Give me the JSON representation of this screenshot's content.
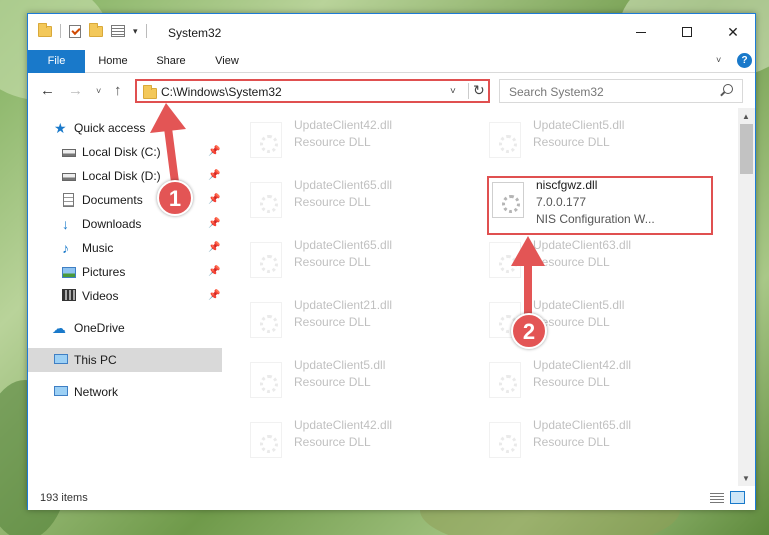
{
  "window": {
    "title": "System32",
    "minimize_icon": "minimize-icon",
    "maximize_icon": "maximize-icon",
    "close_symbol": "✕"
  },
  "ribbon": {
    "tabs": [
      {
        "label": "File"
      },
      {
        "label": "Home"
      },
      {
        "label": "Share"
      },
      {
        "label": "View"
      }
    ],
    "help_label": "?"
  },
  "nav": {
    "back_symbol": "←",
    "forward_symbol": "→",
    "recent_symbol": "˅",
    "up_symbol": "↑",
    "address_path": "C:\\Windows\\System32",
    "address_dropdown_symbol": "˅",
    "refresh_symbol": "↻",
    "search_placeholder": "Search System32"
  },
  "sidebar": {
    "items": [
      {
        "label": "Quick access",
        "icon": "star-icon"
      },
      {
        "label": "Local Disk (C:)",
        "icon": "disk-icon",
        "pinned": true
      },
      {
        "label": "Local Disk (D:)",
        "icon": "disk-icon",
        "pinned": true
      },
      {
        "label": "Documents",
        "icon": "documents-icon",
        "pinned": true
      },
      {
        "label": "Downloads",
        "icon": "downloads-icon",
        "pinned": true
      },
      {
        "label": "Music",
        "icon": "music-icon",
        "pinned": true
      },
      {
        "label": "Pictures",
        "icon": "pictures-icon",
        "pinned": true
      },
      {
        "label": "Videos",
        "icon": "videos-icon",
        "pinned": true
      },
      {
        "label": "OneDrive",
        "icon": "onedrive-icon"
      },
      {
        "label": "This PC",
        "icon": "this-pc-icon",
        "selected": true
      },
      {
        "label": "Network",
        "icon": "network-icon"
      }
    ],
    "pin_symbol": "📌"
  },
  "files": {
    "left_column": [
      {
        "name": "UpdateClient42.dll",
        "desc": "Resource DLL"
      },
      {
        "name": "UpdateClient65.dll",
        "desc": "Resource DLL"
      },
      {
        "name": "UpdateClient65.dll",
        "desc": "Resource DLL"
      },
      {
        "name": "UpdateClient21.dll",
        "desc": "Resource DLL"
      },
      {
        "name": "UpdateClient5.dll",
        "desc": "Resource DLL"
      },
      {
        "name": "UpdateClient42.dll",
        "desc": "Resource DLL"
      }
    ],
    "right_column": [
      {
        "name": "UpdateClient5.dll",
        "desc": "Resource DLL"
      },
      {
        "name": "niscfgwz.dll",
        "desc": "7.0.0.177",
        "line3": "NIS Configuration W...",
        "highlighted": true
      },
      {
        "name": "UpdateClient63.dll",
        "desc": "Resource DLL"
      },
      {
        "name": "UpdateClient5.dll",
        "desc": "Resource DLL"
      },
      {
        "name": "UpdateClient42.dll",
        "desc": "Resource DLL"
      },
      {
        "name": "UpdateClient65.dll",
        "desc": "Resource DLL"
      }
    ]
  },
  "status": {
    "item_count": "193 items"
  },
  "annotations": {
    "badge_1": "1",
    "badge_2": "2",
    "color": "#e35555"
  }
}
